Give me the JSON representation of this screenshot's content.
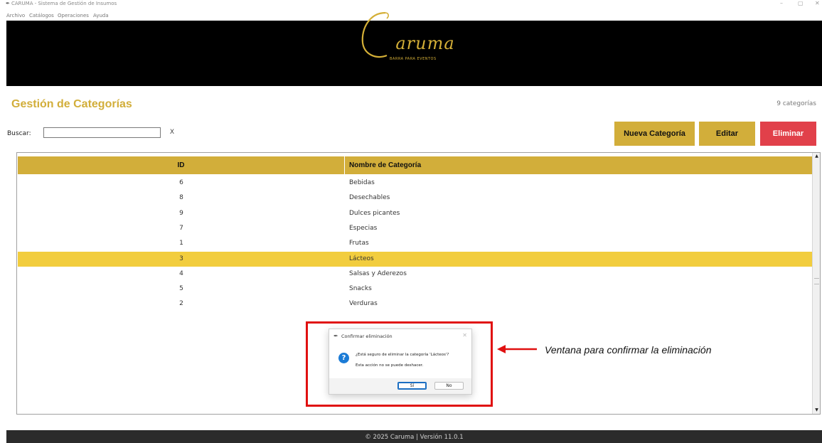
{
  "window": {
    "title": "CARUMA - Sistema de Gestión de Insumos",
    "controls": {
      "minimize": "–",
      "restore": "▢",
      "close": "✕"
    }
  },
  "menu": [
    "Archivo",
    "Catálogos",
    "Operaciones",
    "Ayuda"
  ],
  "brand": {
    "logo_text": "Caruma",
    "tagline": "BARRA PARA EVENTOS",
    "color": "#d4af37"
  },
  "page": {
    "title": "Gestión de Categorías",
    "count_label": "9 categorías"
  },
  "search": {
    "label": "Buscar:",
    "value": "",
    "clear_label": "X"
  },
  "toolbar": {
    "new_label": "Nueva Categoría",
    "edit_label": "Editar",
    "delete_label": "Eliminar"
  },
  "table": {
    "headers": [
      "ID",
      "Nombre de Categoría"
    ],
    "rows": [
      {
        "id": "6",
        "name": "Bebidas"
      },
      {
        "id": "8",
        "name": "Desechables"
      },
      {
        "id": "9",
        "name": "Dulces picantes"
      },
      {
        "id": "7",
        "name": "Especias"
      },
      {
        "id": "1",
        "name": "Frutas"
      },
      {
        "id": "3",
        "name": "Lácteos"
      },
      {
        "id": "4",
        "name": "Salsas y Aderezos"
      },
      {
        "id": "5",
        "name": "Snacks"
      },
      {
        "id": "2",
        "name": "Verduras"
      }
    ],
    "selected_index": 5
  },
  "dialog": {
    "title": "Confirmar eliminación",
    "message": "¿Está seguro de eliminar la categoría 'Lácteos'?",
    "detail": "Esta acción no se puede deshacer.",
    "yes_label": "Sí",
    "no_label": "No",
    "icon": "question-icon"
  },
  "annotation": {
    "text": "Ventana para confirmar la eliminación",
    "color": "#e01010"
  },
  "footer": {
    "text": "© 2025 Caruma | Versión 11.0.1"
  },
  "colors": {
    "accent": "#d2ae3a",
    "selected_row": "#f2cd3e",
    "danger": "#e1404a",
    "header_bg": "#000000",
    "footer_bg": "#2b2b2b"
  }
}
